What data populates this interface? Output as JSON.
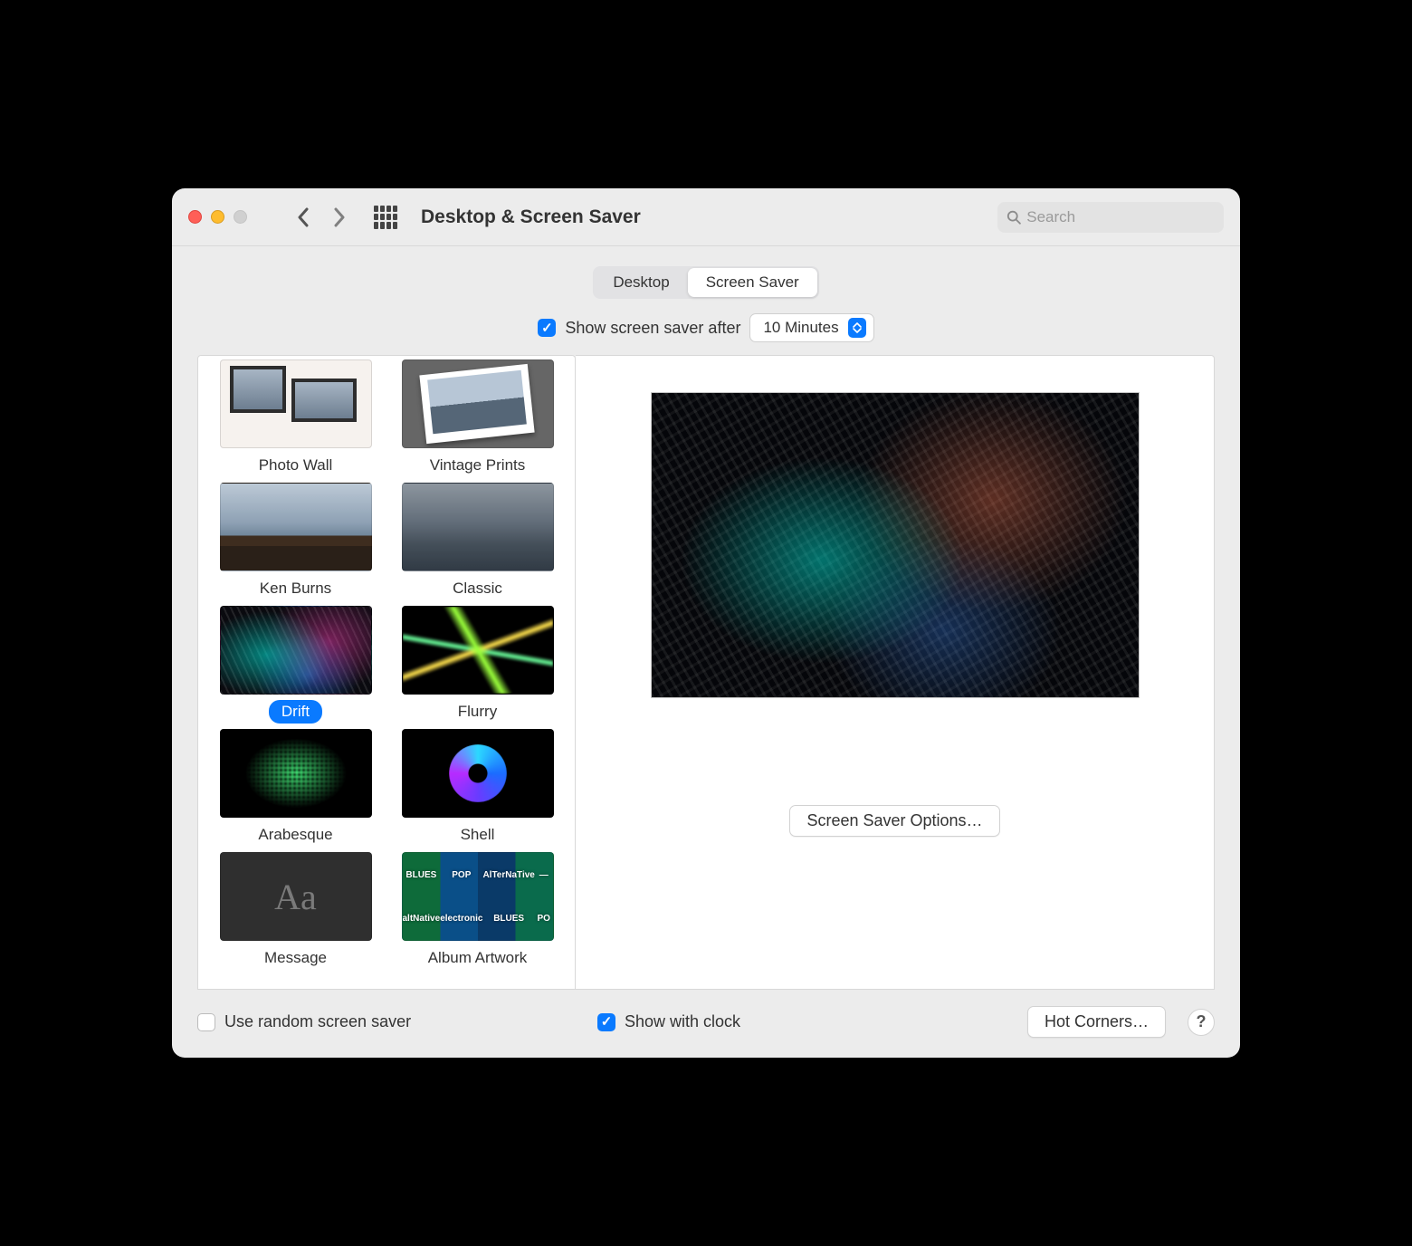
{
  "window": {
    "title": "Desktop & Screen Saver"
  },
  "toolbar": {
    "search_placeholder": "Search"
  },
  "tabs": {
    "desktop": "Desktop",
    "screen_saver": "Screen Saver",
    "active": "screen_saver"
  },
  "show_after": {
    "checked": true,
    "label": "Show screen saver after",
    "value": "10 Minutes"
  },
  "savers": [
    {
      "id": "photo-wall",
      "label": "Photo Wall",
      "thumb": "photo-wall"
    },
    {
      "id": "vintage-prints",
      "label": "Vintage Prints",
      "thumb": "vintage"
    },
    {
      "id": "ken-burns",
      "label": "Ken Burns",
      "thumb": "mountains"
    },
    {
      "id": "classic",
      "label": "Classic",
      "thumb": "classic"
    },
    {
      "id": "drift",
      "label": "Drift",
      "thumb": "drift",
      "selected": true
    },
    {
      "id": "flurry",
      "label": "Flurry",
      "thumb": "flurry"
    },
    {
      "id": "arabesque",
      "label": "Arabesque",
      "thumb": "arabesque"
    },
    {
      "id": "shell",
      "label": "Shell",
      "thumb": "shell"
    },
    {
      "id": "message",
      "label": "Message",
      "thumb": "message"
    },
    {
      "id": "album-artwork",
      "label": "Album Artwork",
      "thumb": "album"
    }
  ],
  "preview": {
    "options_button": "Screen Saver Options…"
  },
  "footer": {
    "random_label": "Use random screen saver",
    "random_checked": false,
    "clock_label": "Show with clock",
    "clock_checked": true,
    "hot_corners": "Hot Corners…",
    "help": "?"
  },
  "message_thumb_text": "Aa"
}
